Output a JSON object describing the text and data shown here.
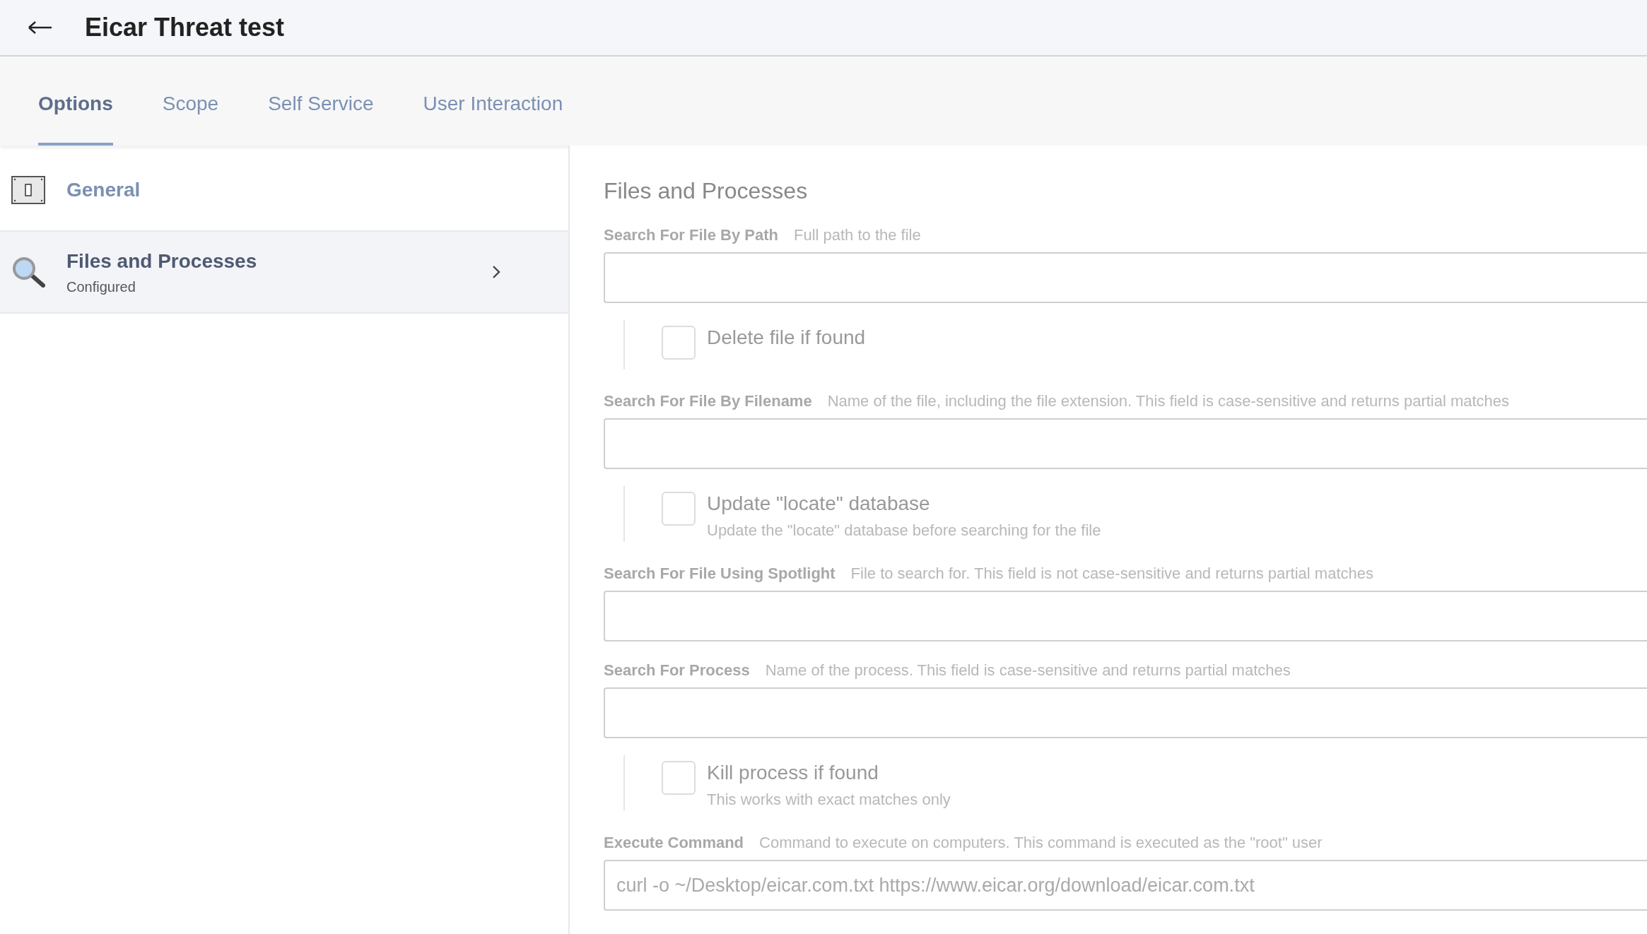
{
  "header": {
    "title": "Eicar Threat test"
  },
  "tabs": [
    {
      "label": "Options",
      "selected": true
    },
    {
      "label": "Scope",
      "selected": false
    },
    {
      "label": "Self Service",
      "selected": false
    },
    {
      "label": "User Interaction",
      "selected": false
    }
  ],
  "sidebar": {
    "items": [
      {
        "kind": "switch",
        "label": "General",
        "selected": false
      },
      {
        "kind": "search",
        "label": "Files and Processes",
        "status": "Configured",
        "selected": true
      }
    ]
  },
  "content": {
    "heading": "Files and Processes",
    "disabled": true,
    "items": [
      {
        "kind": "field",
        "label": "Search For File By Path",
        "hint": "Full path to the file"
      },
      {
        "kind": "checkbox",
        "label": "Delete file if found",
        "checked": false
      },
      {
        "kind": "field",
        "label": "Search For File By Filename",
        "hint": "Name of the file, including the file extension. This field is case-sensitive and returns partial matches"
      },
      {
        "kind": "checkbox",
        "label": "Update \"locate\" database",
        "description": "Update the \"locate\" database before searching for the file",
        "checked": false
      },
      {
        "kind": "field",
        "label": "Search For File Using Spotlight",
        "hint": "File to search for. This field is not case-sensitive and returns partial matches"
      },
      {
        "kind": "field",
        "label": "Search For Process",
        "hint": "Name of the process. This field is case-sensitive and returns partial matches"
      },
      {
        "kind": "checkbox",
        "label": "Kill process if found",
        "description": "This works with exact matches only",
        "checked": false
      },
      {
        "kind": "field",
        "label": "Execute Command",
        "hint": "Command to execute on computers. This command is executed as the \"root\" user",
        "value": "curl -o ~/Desktop/eicar.com.txt https://www.eicar.org/download/eicar.com.txt"
      }
    ]
  }
}
